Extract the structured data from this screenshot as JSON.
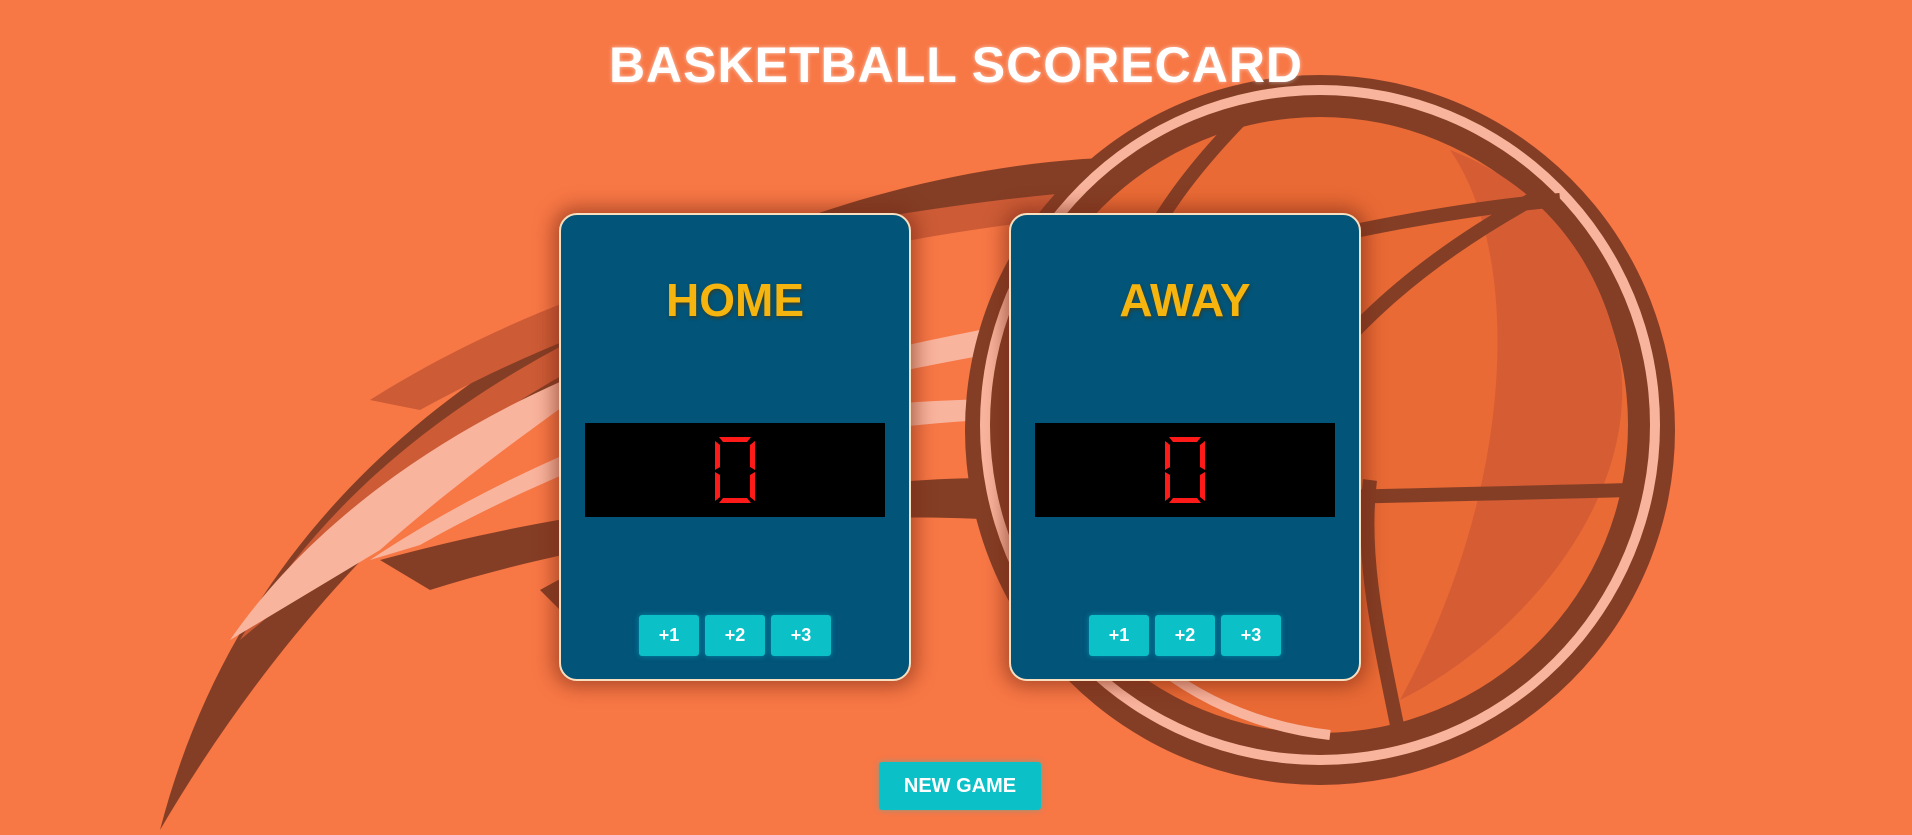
{
  "header": {
    "title": "BASKETBALL SCORECARD"
  },
  "teams": [
    {
      "name": "HOME",
      "score": "0",
      "buttons": [
        "+1",
        "+2",
        "+3"
      ]
    },
    {
      "name": "AWAY",
      "score": "0",
      "buttons": [
        "+1",
        "+2",
        "+3"
      ]
    }
  ],
  "controls": {
    "new_game_label": "NEW GAME"
  },
  "colors": {
    "background": "#f77745",
    "card": "#025478",
    "team_name": "#f6b40e",
    "display_bg": "#000000",
    "digit": "#ff1a1a",
    "button": "#0cc0c8"
  },
  "icons": {
    "background_art": "basketball-flying-icon",
    "digit": "seven-segment-digit"
  }
}
